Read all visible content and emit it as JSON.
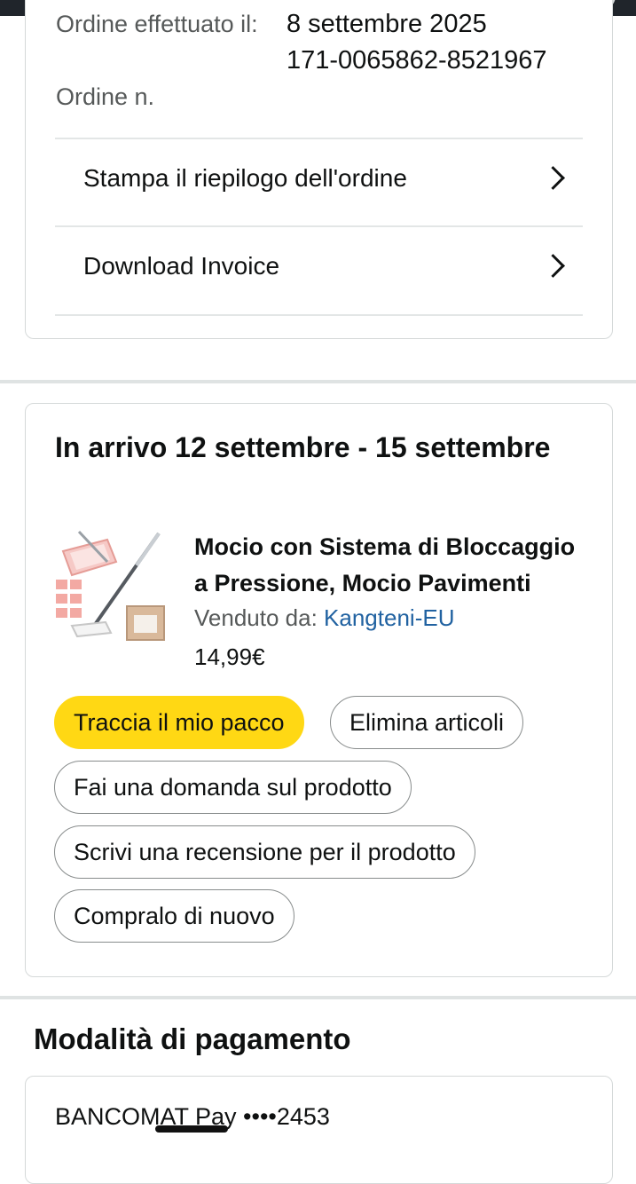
{
  "order_info": {
    "date_label": "Ordine effettuato il:",
    "date_value": "8 settembre 2025",
    "number_label": "Ordine n.",
    "number_value": "171-0065862-8521967"
  },
  "actions": {
    "print_summary": "Stampa il riepilogo dell'ordine",
    "download_invoice": "Download Invoice"
  },
  "delivery": {
    "title": "In arrivo 12 settembre - 15 settembre",
    "product": {
      "title": "Mocio con Sistema di Bloccaggio a Pressione, Mocio Pavimenti",
      "sold_by_label": "Venduto da:",
      "seller": "Kangteni-EU",
      "price": "14,99€"
    },
    "buttons": {
      "track": "Traccia il mio pacco",
      "delete": "Elimina articoli",
      "ask": "Fai una domanda sul prodotto",
      "review": "Scrivi una recensione per il prodotto",
      "buy_again": "Compralo di nuovo"
    }
  },
  "payment": {
    "section_title": "Modalità di pagamento",
    "method": "BANCOMAT Pay ••••2453"
  },
  "colors": {
    "primary_button": "#ffd814",
    "link": "#2162a1"
  }
}
